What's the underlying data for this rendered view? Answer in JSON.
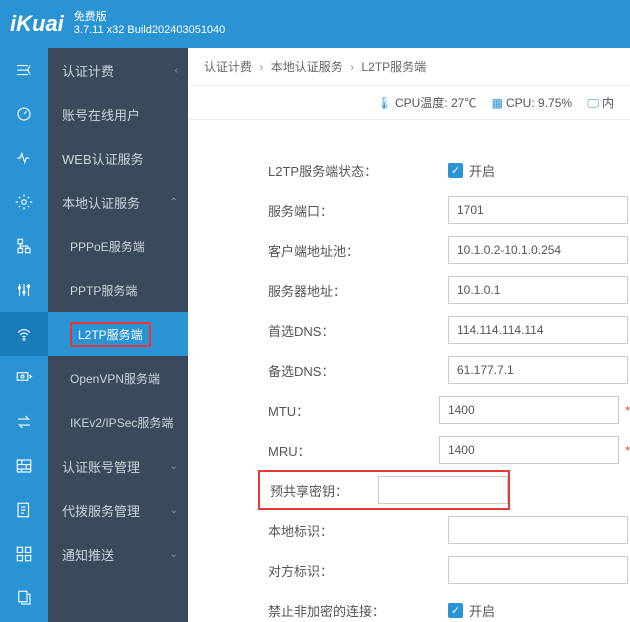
{
  "brand": {
    "logo": "iKuai",
    "edition": "免费版",
    "version": "3.7.11 x32 Build202403051040"
  },
  "sidebar": {
    "items": [
      {
        "label": "认证计费",
        "chev": "‹"
      },
      {
        "label": "账号在线用户"
      },
      {
        "label": "WEB认证服务"
      },
      {
        "label": "本地认证服务",
        "chev": "⌃"
      },
      {
        "label": "PPPoE服务端",
        "sub": true
      },
      {
        "label": "PPTP服务端",
        "sub": true
      },
      {
        "label": "L2TP服务端",
        "sub": true,
        "active": true
      },
      {
        "label": "OpenVPN服务端",
        "sub": true
      },
      {
        "label": "IKEv2/IPSec服务端",
        "sub": true
      },
      {
        "label": "认证账号管理",
        "chev": "⌄"
      },
      {
        "label": "代拨服务管理",
        "chev": "⌄"
      },
      {
        "label": "通知推送",
        "chev": "⌄"
      }
    ]
  },
  "breadcrumb": {
    "a": "认证计费",
    "b": "本地认证服务",
    "c": "L2TP服务端"
  },
  "status": {
    "temp_label": "CPU温度:",
    "temp_val": "27℃",
    "cpu_label": "CPU:",
    "cpu_val": "9.75%",
    "net_label": "内"
  },
  "form": {
    "status_label": "L2TP服务端状态：",
    "status_on": "开启",
    "port_label": "服务端口：",
    "port_val": "1701",
    "client_label": "客户端地址池：",
    "client_val": "10.1.0.2-10.1.0.254",
    "server_label": "服务器地址：",
    "server_val": "10.1.0.1",
    "dns1_label": "首选DNS：",
    "dns1_val": "114.114.114.114",
    "dns2_label": "备选DNS：",
    "dns2_val": "61.177.7.1",
    "mtu_label": "MTU：",
    "mtu_val": "1400",
    "mru_label": "MRU：",
    "mru_val": "1400",
    "psk_label": "预共享密钥：",
    "psk_val": "",
    "local_label": "本地标识：",
    "local_val": "",
    "remote_label": "对方标识：",
    "remote_val": "",
    "deny_label": "禁止非加密的连接：",
    "deny_on": "开启"
  }
}
